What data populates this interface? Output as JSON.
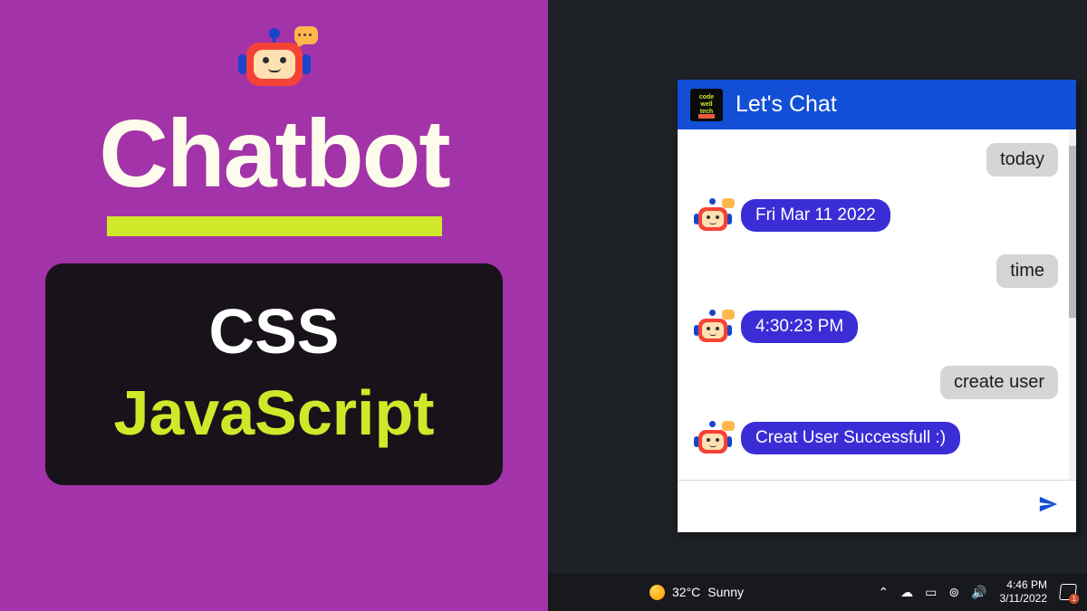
{
  "promo": {
    "title": "Chatbot",
    "tech1": "CSS",
    "tech2": "JavaScript"
  },
  "chat": {
    "brand_text": "code\nwell\ntech",
    "header_title": "Let's Chat",
    "messages": [
      {
        "role": "user",
        "text": "today"
      },
      {
        "role": "bot",
        "text": "Fri Mar 11 2022"
      },
      {
        "role": "user",
        "text": "time"
      },
      {
        "role": "bot",
        "text": "4:30:23 PM"
      },
      {
        "role": "user",
        "text": "create user"
      },
      {
        "role": "bot",
        "text": "Creat User Successfull :)"
      }
    ]
  },
  "taskbar": {
    "temperature": "32°C",
    "condition": "Sunny",
    "time": "4:46 PM",
    "date": "3/11/2022",
    "notif_count": "1"
  }
}
